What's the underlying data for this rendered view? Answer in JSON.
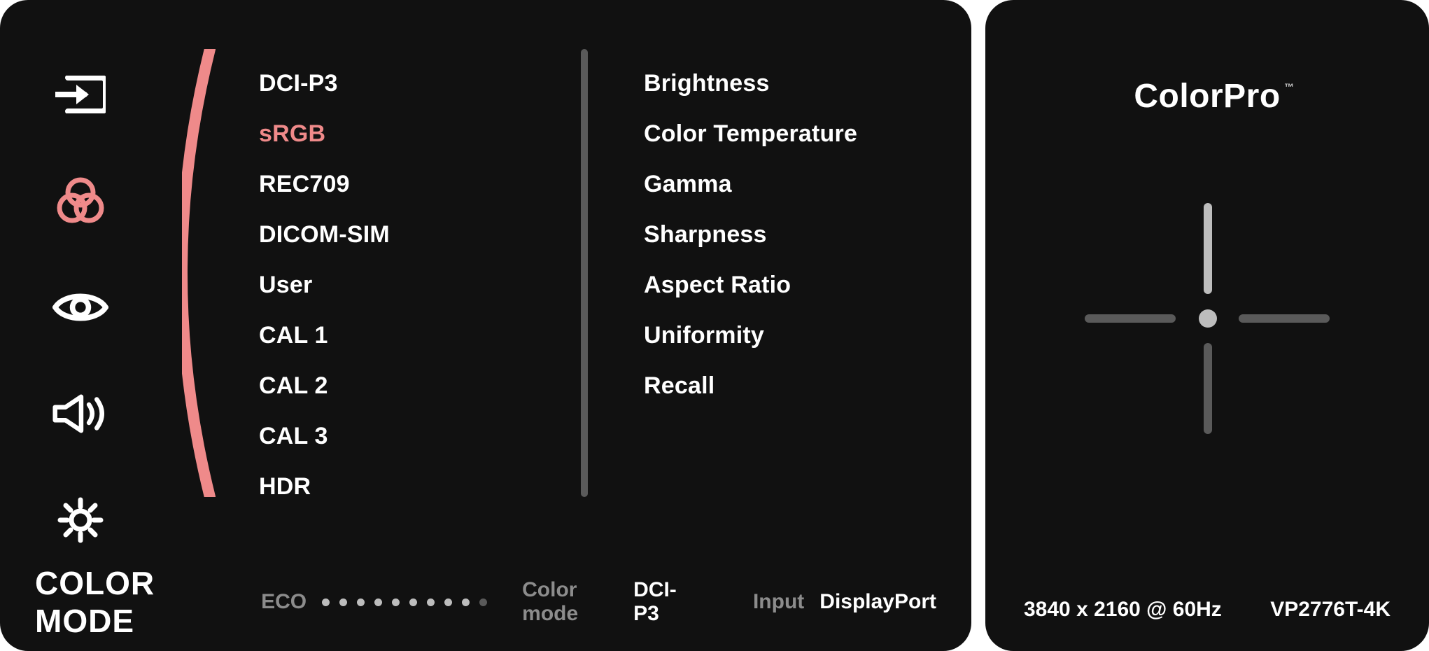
{
  "nav_icons": [
    {
      "name": "input-icon",
      "selected": false
    },
    {
      "name": "color-icon",
      "selected": true
    },
    {
      "name": "eye-icon",
      "selected": false
    },
    {
      "name": "audio-icon",
      "selected": false
    },
    {
      "name": "gear-icon",
      "selected": false
    }
  ],
  "color_modes": {
    "items": [
      {
        "label": "DCI-P3",
        "selected": false
      },
      {
        "label": "sRGB",
        "selected": true
      },
      {
        "label": "REC709",
        "selected": false
      },
      {
        "label": "DICOM-SIM",
        "selected": false
      },
      {
        "label": "User",
        "selected": false
      },
      {
        "label": "CAL 1",
        "selected": false
      },
      {
        "label": "CAL 2",
        "selected": false
      },
      {
        "label": "CAL 3",
        "selected": false
      },
      {
        "label": "HDR",
        "selected": false
      }
    ]
  },
  "image_adjust": {
    "items": [
      "Brightness",
      "Color Temperature",
      "Gamma",
      "Sharpness",
      "Aspect Ratio",
      "Uniformity",
      "Recall"
    ]
  },
  "footer": {
    "title": "COLOR MODE",
    "eco": {
      "label": "ECO",
      "level": 9,
      "total": 10
    },
    "mode": {
      "label": "Color mode",
      "value": "DCI-P3"
    },
    "input": {
      "label": "Input",
      "value": "DisplayPort"
    }
  },
  "right": {
    "brand": "ColorPro",
    "tm": "™",
    "resolution": "3840 x 2160 @ 60Hz",
    "model": "VP2776T-4K",
    "joystick_active": "up"
  },
  "colors": {
    "accent": "#ef8a8a",
    "bg": "#111111",
    "muted": "#5a5a5a"
  }
}
